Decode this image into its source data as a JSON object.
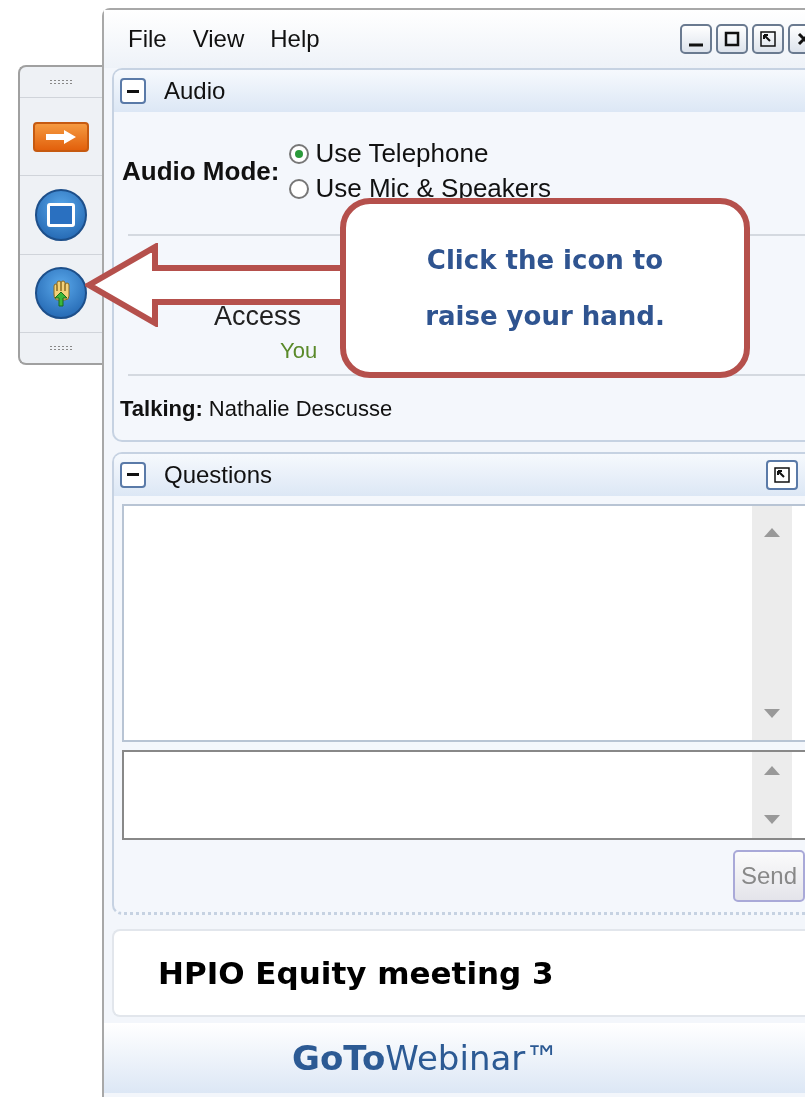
{
  "toolbar": [
    {
      "kind": "arrow"
    },
    {
      "kind": "screen"
    },
    {
      "kind": "hand"
    }
  ],
  "menu": [
    "File",
    "View",
    "Help"
  ],
  "window_controls": [
    {
      "kind": "minimize"
    },
    {
      "kind": "maximize"
    },
    {
      "kind": "restore"
    },
    {
      "kind": "close"
    }
  ],
  "audio_panel": {
    "title": "Audio",
    "mode_label": "Audio Mode:",
    "options": [
      {
        "label": "Use Telephone",
        "selected": true
      },
      {
        "label": "Use Mic & Speakers",
        "selected": false
      }
    ],
    "access_text": "Access",
    "status_text": "You",
    "talking": "**Talking:** Nathalie Descusse"
  },
  "questions_panel": {
    "title": "Questions",
    "send_button": {
      "label": "Send",
      "disabled": true
    }
  },
  "meeting_title": "HPIO Equity meeting 3",
  "logo": "**GoTo**Webinar™",
  "callout": {
    "text": "Click the icon to raise your hand."
  }
}
